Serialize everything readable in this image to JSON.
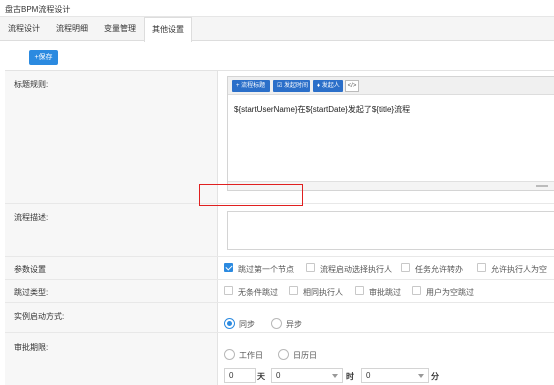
{
  "window": {
    "title": "盘古BPM流程设计"
  },
  "tabs": [
    {
      "label": "流程设计"
    },
    {
      "label": "流程明细"
    },
    {
      "label": "变量管理"
    },
    {
      "label": "其他设置"
    }
  ],
  "active_tab": "其他设置",
  "toolbar": {
    "save_label": "+保存"
  },
  "form": {
    "title_rule": {
      "label": "标题规则:",
      "buttons": [
        {
          "label": "+ 流程标题",
          "icon": "plus-icon"
        },
        {
          "label": "☑ 发起时间",
          "icon": "edit-icon"
        },
        {
          "label": "♦ 发起人",
          "icon": "user-icon"
        }
      ],
      "code_button": "</>",
      "value": "${startUserName}在${startDate}发起了${title}流程"
    },
    "description": {
      "label": "流程描述:",
      "value": ""
    },
    "params": {
      "label": "参数设置",
      "options": [
        {
          "label": "跳过第一个节点",
          "checked": true
        },
        {
          "label": "流程启动选择执行人",
          "checked": false
        },
        {
          "label": "任务允许转办",
          "checked": false
        },
        {
          "label": "允许执行人为空",
          "checked": false
        }
      ]
    },
    "skip_type": {
      "label": "跳过类型:",
      "options": [
        {
          "label": "无条件跳过",
          "checked": false
        },
        {
          "label": "相同执行人",
          "checked": false
        },
        {
          "label": "审批跳过",
          "checked": false
        },
        {
          "label": "用户为空跳过",
          "checked": false
        }
      ]
    },
    "instance_start": {
      "label": "实例启动方式:",
      "options": [
        {
          "label": "同步",
          "selected": true
        },
        {
          "label": "异步",
          "selected": false
        }
      ]
    },
    "approval_deadline": {
      "label": "审批期限:",
      "options": [
        {
          "label": "工作日",
          "selected": false
        },
        {
          "label": "日历日",
          "selected": false
        }
      ],
      "days_value": "0",
      "days_unit": "天",
      "hours_value": "0",
      "hours_unit": "时",
      "minutes_value": "0",
      "minutes_unit": "分"
    }
  },
  "colors": {
    "accent": "#2b8ae0",
    "highlight": "#e02020"
  }
}
